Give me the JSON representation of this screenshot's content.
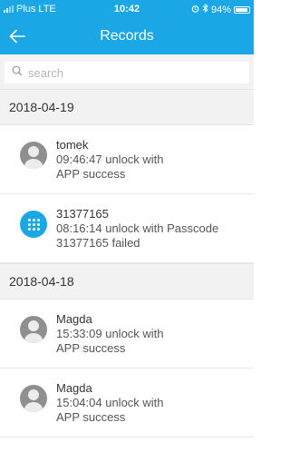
{
  "status_bar": {
    "carrier": "Plus",
    "network": "LTE",
    "time": "10:42",
    "battery": "94%"
  },
  "header": {
    "title": "Records",
    "back_icon": "arrow-left-icon"
  },
  "search": {
    "placeholder": "search"
  },
  "groups": [
    {
      "date": "2018-04-19",
      "records": [
        {
          "icon": "user-avatar-icon",
          "name": "tomek",
          "line1": "09:46:47 unlock with",
          "line2": "APP success"
        },
        {
          "icon": "keypad-icon",
          "name": "31377165",
          "line1": "08:16:14 unlock with Passcode",
          "line2": "31377165 failed"
        }
      ]
    },
    {
      "date": "2018-04-18",
      "records": [
        {
          "icon": "user-avatar-icon",
          "name": "Magda",
          "line1": "15:33:09 unlock with",
          "line2": "APP success"
        },
        {
          "icon": "user-avatar-icon",
          "name": "Magda",
          "line1": "15:04:04 unlock with",
          "line2": "APP success"
        }
      ]
    }
  ],
  "colors": {
    "accent": "#1ba6e6",
    "section_bg": "#f2f2f2"
  }
}
